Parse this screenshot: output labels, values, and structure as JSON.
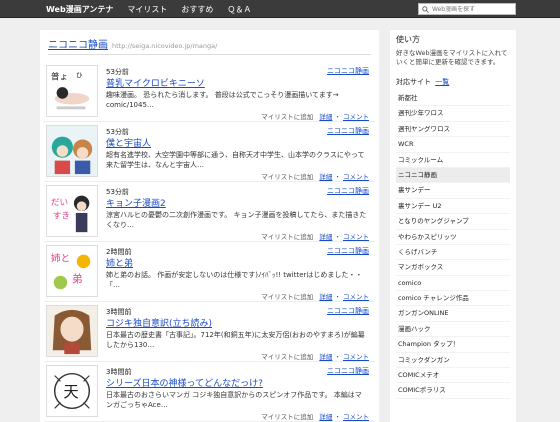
{
  "nav": {
    "brand": "Web漫画アンテナ",
    "items": [
      "マイリスト",
      "おすすめ",
      "Ｑ＆Ａ"
    ],
    "search_placeholder": "Web漫画を探す"
  },
  "site": {
    "name": "ニコニコ静画",
    "url": "http://seiga.nicovideo.jp/manga/"
  },
  "entries": [
    {
      "time": "53分前",
      "badge": "ニコニコ静画",
      "title": "普乳マイクロビキニーソ",
      "desc": "趣味漫画。 恐られたら消します。 普段は公式でこっそり漫画描いてます→ comic/1045…",
      "add": "マイリストに追加",
      "detail": "詳細",
      "comment": "コメント"
    },
    {
      "time": "53分前",
      "badge": "ニコニコ静画",
      "title": "僕と宇宙人",
      "desc": "超有名進学校、大空学園中等部に通う、自称天才中学生、山本学のクラスにやって来た留学生は、なんと宇宙人…",
      "add": "マイリストに追加",
      "detail": "詳細",
      "comment": "コメント"
    },
    {
      "time": "53分前",
      "badge": "ニコニコ静画",
      "title": "キョン子漫画2",
      "desc": "涼宮ハルヒの憂鬱の二次創作漫画です。 キョン子漫画を投稿してたら、また描きたくなり…",
      "add": "マイリストに追加",
      "detail": "詳細",
      "comment": "コメント"
    },
    {
      "time": "2時間前",
      "badge": "ニコニコ静画",
      "title": "姉と弟",
      "desc": "姉と弟のお話。 作画が安定しないのは仕様です)ﾉｲﾊﾞｯ!! twitterはじめました・・「…",
      "add": "マイリストに追加",
      "detail": "詳細",
      "comment": "コメント"
    },
    {
      "time": "3時間前",
      "badge": "ニコニコ静画",
      "title": "コジキ独自意訳(立ち読み)",
      "desc": "日本最古の歴史書「古事記」。712年(和銅五年)に太安万侶(おおのやすまろ)が編纂したから130…",
      "add": "マイリストに追加",
      "detail": "詳細",
      "comment": "コメント"
    },
    {
      "time": "3時間前",
      "badge": "ニコニコ静画",
      "title": "シリーズ日本の神様ってどんなだっけ?",
      "desc": "日本最古のおさらいマンガ コジキ独自意訳からのスピンオフ作品です。 本編はマンガごっちゃAce…",
      "add": "マイリストに追加",
      "detail": "詳細",
      "comment": "コメント"
    }
  ],
  "sidebar": {
    "title": "使い方",
    "desc": "好きなWeb漫画をマイリストに入れていくと簡単に更新を確認できます。",
    "sites_heading": "対応サイト",
    "sites_link": "一覧",
    "sites": [
      "新都社",
      "週刊少年ワロス",
      "週刊ヤングワロス",
      "WCR",
      "コミックルーム",
      "ニコニコ静画",
      "裏サンデー",
      "裏サンデー U2",
      "となりのヤングジャンプ",
      "やわらかスピリッツ",
      "くらげバンチ",
      "マンガボックス",
      "comico",
      "comico チャレンジ作品",
      "ガンガンONLINE",
      "漫画ハック",
      "Champion タップ！",
      "コミックダンガン",
      "COMICメテオ",
      "COMICポラリス"
    ],
    "active_site": "ニコニコ静画"
  },
  "colors": {
    "topbar": "#3b3b3b",
    "link": "#1a4cc8",
    "background": "#efefef"
  }
}
